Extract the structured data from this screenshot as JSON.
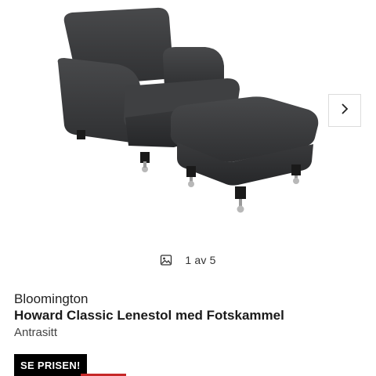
{
  "gallery": {
    "image_alt": "Howard Classic Lenestol med Fotskammel",
    "pager_text": "1 av 5",
    "next_icon": "chevron-right-icon",
    "pager_icon": "image-icon"
  },
  "product": {
    "brand": "Bloomington",
    "title": "Howard Classic Lenestol med Fotskammel",
    "variant": "Antrasitt"
  },
  "cta": {
    "label": "SE PRISEN!"
  },
  "colors": {
    "cta_background": "#000000",
    "cta_text": "#ffffff",
    "accent_strip": "#c62828",
    "upholstery": "#3a3b3d"
  }
}
